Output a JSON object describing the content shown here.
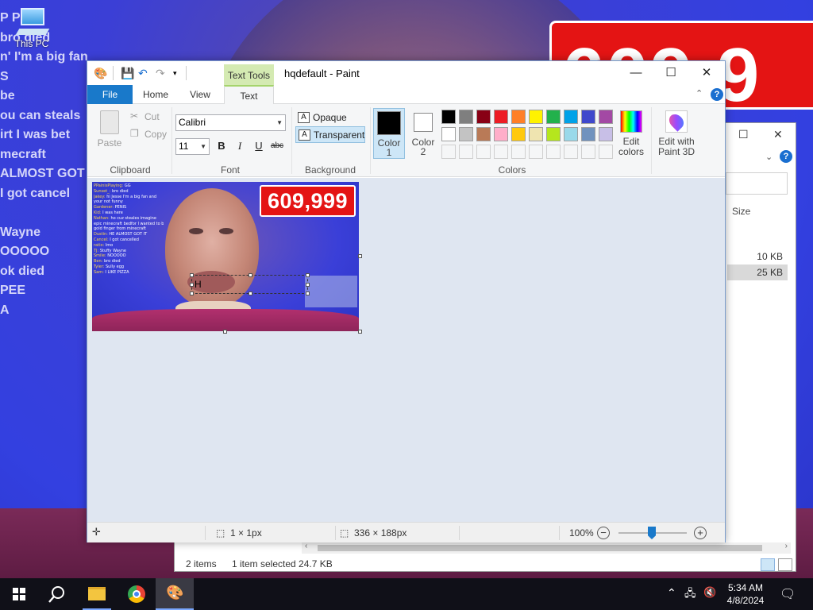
{
  "desktop": {
    "icon_label": "This PC",
    "wallpaper_counter": "609,9",
    "wallpaper_chat": [
      "P Pai",
      "bro died",
      "n' I'm a big fan",
      "S",
      "be",
      "ou can steals",
      "irt I was bet",
      "mecraft",
      "ALMOST GOT",
      "I got cancel",
      "",
      "Wayne",
      "OOOOO",
      "ok died",
      "PEE",
      "A"
    ]
  },
  "paint": {
    "title": "hqdefault - Paint",
    "context_tab": "Text Tools",
    "tabs": [
      "File",
      "Home",
      "View",
      "Text"
    ],
    "active_tab": "Text",
    "clipboard": {
      "paste": "Paste",
      "cut": "Cut",
      "copy": "Copy",
      "label": "Clipboard"
    },
    "font": {
      "family": "Calibri",
      "size": "11",
      "bold": "B",
      "italic": "I",
      "underline": "U",
      "strike": "abc",
      "label": "Font"
    },
    "background": {
      "opaque": "Opaque",
      "transparent": "Transparent",
      "selected": "Transparent",
      "label": "Background"
    },
    "colors": {
      "color1_label": "Color\n1",
      "color1_a": "Color",
      "color1_b": "1",
      "color2_a": "Color",
      "color2_b": "2",
      "color1": "#000000",
      "color2": "#ffffff",
      "palette_row1": [
        "#000000",
        "#7f7f7f",
        "#880015",
        "#ed1c24",
        "#ff7f27",
        "#fff200",
        "#22b14c",
        "#00a2e8",
        "#3f48cc",
        "#a349a4"
      ],
      "palette_row2": [
        "#ffffff",
        "#c3c3c3",
        "#b97a57",
        "#ffaec9",
        "#ffc90e",
        "#efe4b0",
        "#b5e61d",
        "#99d9ea",
        "#7092be",
        "#c8bfe7"
      ],
      "edit_colors_a": "Edit",
      "edit_colors_b": "colors",
      "label": "Colors"
    },
    "paint3d_a": "Edit with",
    "paint3d_b": "Paint 3D",
    "canvas": {
      "counter": "609,999",
      "typed_text": "H",
      "chat": [
        {
          "n": "PPainisPlaying",
          "m": "GG"
        },
        {
          "n": "Sunset_",
          "m": "bro died"
        },
        {
          "n": "Jakey",
          "m": "hi Jesse I'm a big fan and"
        },
        {
          "n": "",
          "m": "your not funny"
        },
        {
          "n": "Gardener",
          "m": "PENIS"
        },
        {
          "n": "Kid",
          "m": "I was here"
        },
        {
          "n": "Nathan",
          "m": "ho cuz steales imagine"
        },
        {
          "n": "",
          "m": "epic minecraft bedfor I wanted to be"
        },
        {
          "n": "",
          "m": "gold finger from minecraft"
        },
        {
          "n": "Dustin",
          "m": "HE ALMOST GOT IT"
        },
        {
          "n": "Cancel",
          "m": "I got cancelled"
        },
        {
          "n": "ratio",
          "m": "lmo"
        },
        {
          "n": "TJ",
          "m": "Stuffy Wayne"
        },
        {
          "n": "Smile",
          "m": "NOOOOO"
        },
        {
          "n": "Ben",
          "m": "bro died"
        },
        {
          "n": "Tyler",
          "m": "Sully egg"
        },
        {
          "n": "Sam",
          "m": "I LIKE PIZZA"
        }
      ]
    },
    "status": {
      "cursor_size": "1 × 1px",
      "image_size": "336 × 188px",
      "zoom": "100%"
    }
  },
  "explorer": {
    "column_size": "Size",
    "rows": [
      "10 KB",
      "25 KB"
    ],
    "status_items": "2 items",
    "status_selected": "1 item selected  24.7 KB"
  },
  "taskbar": {
    "time": "5:34 AM",
    "date": "4/8/2024"
  }
}
